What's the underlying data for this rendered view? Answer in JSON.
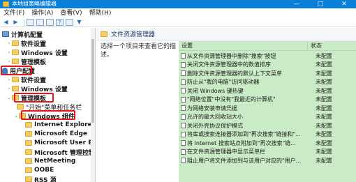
{
  "window": {
    "title": "本地组策略编辑器",
    "controls": [
      "—",
      "□",
      "✕"
    ]
  },
  "menu": [
    "文件(F)",
    "操作(A)",
    "查看(V)",
    "帮助(H)"
  ],
  "toolbar_icons": [
    "back-arrow-icon",
    "forward-arrow-icon",
    "up-folder-icon",
    "show-hide-tree-icon",
    "export-list-icon",
    "help-icon",
    "filter-icon"
  ],
  "tree": {
    "computer_config": "计算机配置",
    "cc_software": "软件设置",
    "cc_windows": "Windows 设置",
    "cc_admin": "管理模板",
    "user_config": "用户配置",
    "uc_software": "软件设置",
    "uc_windows": "Windows 设置",
    "uc_admin": "管理模板",
    "start_menu": "\"开始\"菜单和任务栏",
    "windows_components": "Windows 组件",
    "children": [
      "Internet Explorer",
      "Microsoft Edge",
      "Microsoft User Exp",
      "Microsoft 管理控制",
      "NetMeeting",
      "OOBE",
      "RSS 源"
    ]
  },
  "panel": {
    "title": "文件资源管理器",
    "description": "选择一个项目来查看它的描述。",
    "col_setting": "设置",
    "col_state": "状态"
  },
  "rows": [
    {
      "name": "从文件资源管理器中删除\"搜索\"按钮",
      "state": "未配置"
    },
    {
      "name": "关闭文件资源管理器中的数值排序",
      "state": "未配置"
    },
    {
      "name": "删除文件资源管理器的默认上下文菜单",
      "state": "未配置"
    },
    {
      "name": "防止从\"我的电脑\"访问驱动器",
      "state": "未配置"
    },
    {
      "name": "关闭 Windows 键热键",
      "state": "未配置"
    },
    {
      "name": "\"网络位置\"中没有\"我最近的计算机\"",
      "state": "未配置"
    },
    {
      "name": "为网络安装申请凭据",
      "state": "未配置"
    },
    {
      "name": "允许的最大回收站大小",
      "state": "未配置"
    },
    {
      "name": "关闭外壳协议保护模式",
      "state": "未配置"
    },
    {
      "name": "将库或搜索连接器添加到\"再次搜索\"链接和\"...",
      "state": "未配置"
    },
    {
      "name": "将 Internet 搜索站点附加到\"再次搜索\"链...",
      "state": "未配置"
    },
    {
      "name": "在文件资源管理器中显示菜单栏",
      "state": "未配置"
    },
    {
      "name": "阻止用户将文件添加到与该用户对应的\"用户...",
      "state": "未配置"
    }
  ]
}
